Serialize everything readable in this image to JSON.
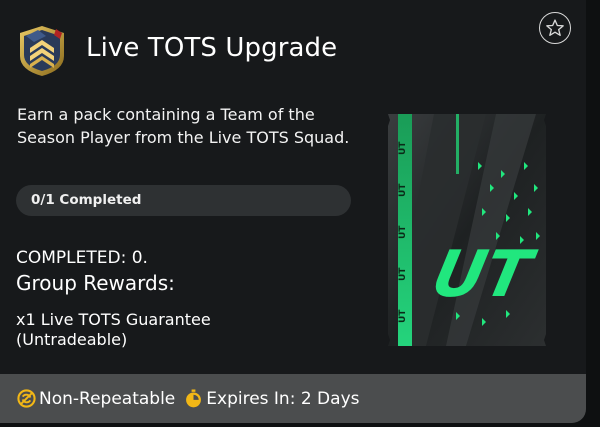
{
  "objective": {
    "title": "Live TOTS Upgrade",
    "description": "Earn a pack containing a Team of the Season Player from the Live TOTS Squad.",
    "progress": {
      "label": "0/1 Completed",
      "completed": 0,
      "total": 1
    },
    "completed_text": "COMPLETED: 0.",
    "group_rewards_title": "Group Rewards:",
    "reward_text": "x1 Live TOTS Guarantee (Untradeable)",
    "pack_logo": "UT"
  },
  "footer": {
    "repeat_label": "Non-Repeatable",
    "expiry_label": "Expires In: 2 Days"
  },
  "icons": {
    "badge": "tots-chevron-badge-icon",
    "favorite": "star-outline-icon",
    "repeat": "non-repeatable-icon",
    "timer": "stopwatch-icon"
  },
  "colors": {
    "background": "#17191b",
    "progress_track": "#2e3133",
    "footer_bg": "#4b4d4e",
    "accent_green": "#21e77e",
    "icon_gold": "#f2b716",
    "badge_gold": "#c9a43a"
  }
}
